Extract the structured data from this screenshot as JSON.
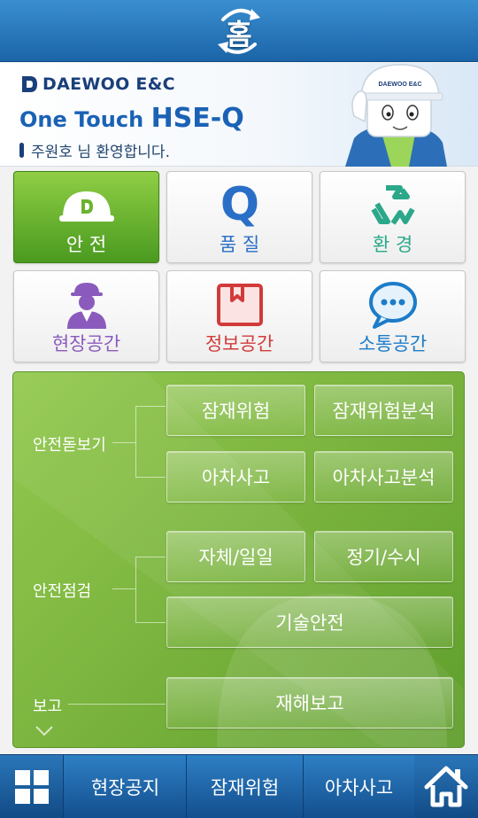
{
  "header": {
    "title": "홈"
  },
  "banner": {
    "brand": "DAEWOO E&C",
    "tagline_prefix": "One Touch",
    "tagline_main": "HSE-Q",
    "welcome": "주원호 님 환영합니다.",
    "mascot_helmet_text": "DAEWOO E&C"
  },
  "tiles": [
    {
      "label": "안 전",
      "icon": "helmet-icon",
      "color": "#ffffff"
    },
    {
      "label": "품 질",
      "icon": "q-icon",
      "color": "#2a6fc7"
    },
    {
      "label": "환 경",
      "icon": "recycle-icon",
      "color": "#2aa889"
    },
    {
      "label": "현장공간",
      "icon": "worker-icon",
      "color": "#8a5bbd"
    },
    {
      "label": "정보공간",
      "icon": "info-box-icon",
      "color": "#d23a3a"
    },
    {
      "label": "소통공간",
      "icon": "speech-bubble-icon",
      "color": "#1c7cc8"
    }
  ],
  "safety_panel": {
    "sections": [
      {
        "label": "안전돋보기",
        "buttons": [
          "잠재위험",
          "잠재위험분석",
          "아차사고",
          "아차사고분석"
        ]
      },
      {
        "label": "안전점검",
        "buttons": [
          "자체/일일",
          "정기/수시",
          "기술안전"
        ]
      },
      {
        "label": "보고",
        "buttons": [
          "재해보고"
        ]
      }
    ]
  },
  "bottom_nav": {
    "tabs": [
      "현장공지",
      "잠재위험",
      "아차사고"
    ]
  },
  "colors": {
    "topbar": "#1f6fb7",
    "panel_green": "#7db640",
    "active_tile": "#6bb32e"
  }
}
